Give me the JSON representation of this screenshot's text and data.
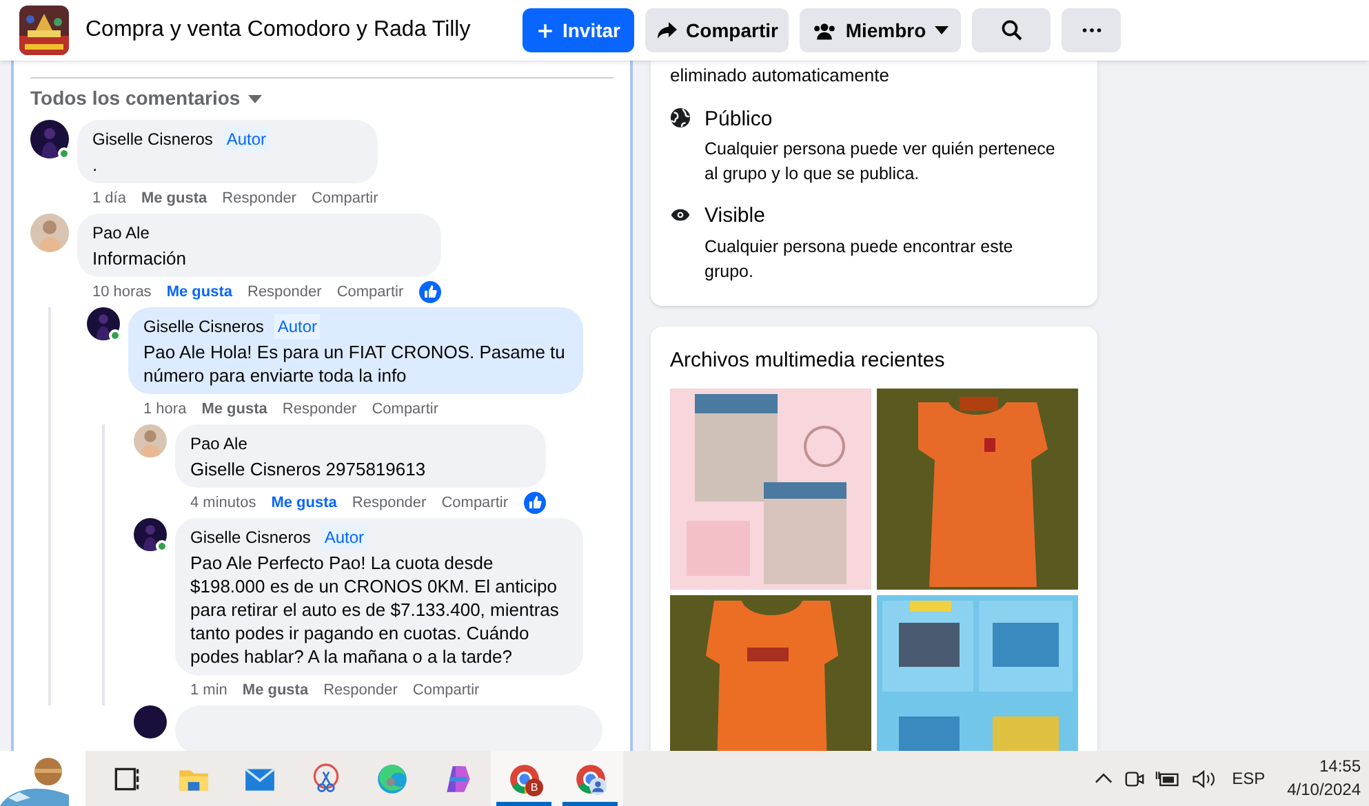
{
  "header": {
    "title": "Compra y venta Comodoro y Rada Tilly",
    "buttons": [
      {
        "kind": "invite",
        "label": "Invitar"
      },
      {
        "kind": "share",
        "label": "Compartir"
      },
      {
        "kind": "member",
        "label": "Miembro"
      },
      {
        "kind": "search"
      },
      {
        "kind": "more"
      }
    ]
  },
  "comments_filter": {
    "label": "Todos los comentarios"
  },
  "comments": [
    {
      "author": "Giselle Cisneros",
      "badge": "Autor",
      "online": true,
      "highlighted": false,
      "text": ".",
      "time": "1 día",
      "liked": false,
      "actions": [
        "Me gusta",
        "Responder",
        "Compartir"
      ]
    },
    {
      "author": "Pao Ale",
      "online": false,
      "highlighted": false,
      "text": "Información",
      "time": "10 horas",
      "liked": true,
      "reaction": true,
      "actions": [
        "Me gusta",
        "Responder",
        "Compartir"
      ],
      "children": [
        {
          "author": "Giselle Cisneros",
          "badge": "Autor",
          "online": true,
          "highlighted": true,
          "text": "**Pao Ale** Hola! Es para un FIAT CRONOS. Pasame tu número para enviarte toda la info",
          "time": "1 hora",
          "liked": false,
          "actions": [
            "Me gusta",
            "Responder",
            "Compartir"
          ],
          "children": [
            {
              "author": "Pao Ale",
              "online": false,
              "highlighted": false,
              "text": "**Giselle Cisneros** 2975819613",
              "time": "4 minutos",
              "liked": true,
              "reaction": true,
              "actions": [
                "Me gusta",
                "Responder",
                "Compartir"
              ]
            },
            {
              "author": "Giselle Cisneros",
              "badge": "Autor",
              "online": true,
              "highlighted": false,
              "text": "**Pao Ale** Perfecto Pao! La cuota desde $198.000 es de un CRONOS 0KM. El anticipo para retirar el auto es de $7.133.400, mientras tanto podes ir pagando en cuotas. Cuándo podes hablar? A la mañana o a la tarde?",
              "time": "1 min",
              "liked": false,
              "actions": [
                "Me gusta",
                "Responder",
                "Compartir"
              ]
            }
          ]
        }
      ]
    }
  ],
  "about": {
    "intro": "eliminado automaticamente",
    "items": [
      {
        "title": "Público",
        "description": "Cualquier persona puede ver quién pertenece al grupo y lo que se publica."
      },
      {
        "title": "Visible",
        "description": "Cualquier persona puede encontrar este grupo."
      }
    ]
  },
  "media": {
    "title": "Archivos multimedia recientes"
  },
  "taskbar": {
    "apps": [
      {
        "active": false
      },
      {
        "active": false
      },
      {
        "active": false
      },
      {
        "active": false
      },
      {
        "active": false
      },
      {
        "active": false
      },
      {
        "active": true,
        "badge": "B"
      },
      {
        "active": true
      }
    ],
    "language": "ESP",
    "time": "14:55",
    "date": "4/10/2024"
  }
}
